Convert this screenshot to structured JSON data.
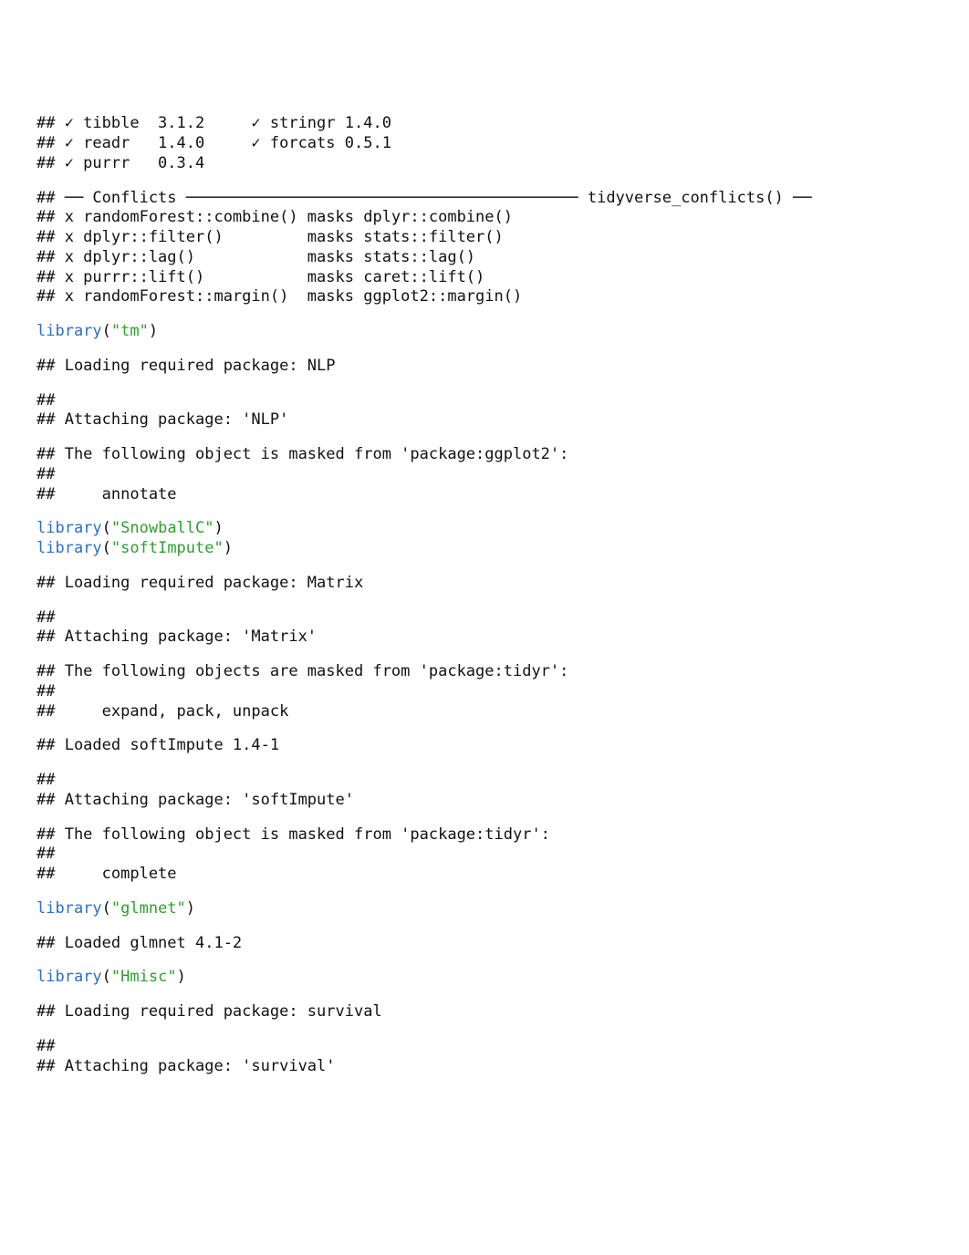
{
  "blocks": [
    {
      "lines": [
        "## ✓ tibble  3.1.2     ✓ stringr 1.4.0",
        "## ✓ readr   1.4.0     ✓ forcats 0.5.1",
        "## ✓ purrr   0.3.4"
      ]
    },
    {
      "lines": [
        "## ── Conflicts ────────────────────────────────────────── tidyverse_conflicts() ──",
        "## x randomForest::combine() masks dplyr::combine()",
        "## x dplyr::filter()         masks stats::filter()",
        "## x dplyr::lag()            masks stats::lag()",
        "## x purrr::lift()           masks caret::lift()",
        "## x randomForest::margin()  masks ggplot2::margin()"
      ]
    },
    {
      "code": {
        "pkg": "tm"
      }
    },
    {
      "lines": [
        "## Loading required package: NLP"
      ]
    },
    {
      "lines": [
        "## ",
        "## Attaching package: 'NLP'"
      ]
    },
    {
      "lines": [
        "## The following object is masked from 'package:ggplot2':",
        "## ",
        "##     annotate"
      ]
    },
    {
      "multicode": [
        {
          "pkg": "SnowballC"
        },
        {
          "pkg": "softImpute"
        }
      ]
    },
    {
      "lines": [
        "## Loading required package: Matrix"
      ]
    },
    {
      "lines": [
        "## ",
        "## Attaching package: 'Matrix'"
      ]
    },
    {
      "lines": [
        "## The following objects are masked from 'package:tidyr':",
        "## ",
        "##     expand, pack, unpack"
      ]
    },
    {
      "lines": [
        "## Loaded softImpute 1.4-1"
      ]
    },
    {
      "lines": [
        "## ",
        "## Attaching package: 'softImpute'"
      ]
    },
    {
      "lines": [
        "## The following object is masked from 'package:tidyr':",
        "## ",
        "##     complete"
      ]
    },
    {
      "code": {
        "pkg": "glmnet"
      }
    },
    {
      "lines": [
        "## Loaded glmnet 4.1-2"
      ]
    },
    {
      "code": {
        "pkg": "Hmisc"
      }
    },
    {
      "lines": [
        "## Loading required package: survival"
      ]
    },
    {
      "lines": [
        "## ",
        "## Attaching package: 'survival'"
      ]
    }
  ],
  "libcall": {
    "fn": "library",
    "open": "(",
    "q": "\"",
    "close": ")"
  }
}
